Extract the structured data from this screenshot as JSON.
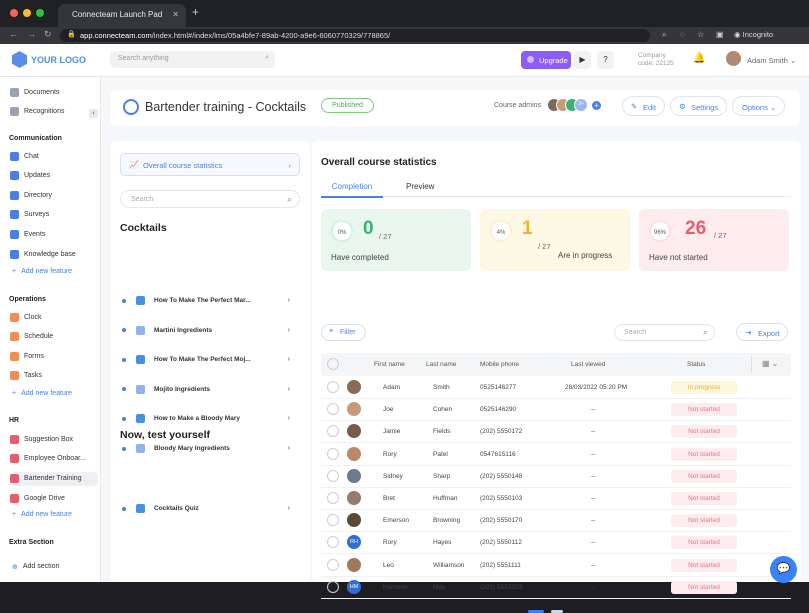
{
  "browser": {
    "tab_title": "Connecteam Launch Pad",
    "url_domain": "app.connecteam.com",
    "url_path": "/index.html#/index/lms/05a4bfe7-89ab-4200-a9e6-6060770329/778865/",
    "incognito": "Incognito"
  },
  "topbar": {
    "logo": "YOUR LOGO",
    "search_placeholder": "Search anything",
    "upgrade": "Upgrade",
    "play": "▶",
    "help": "?",
    "company_line1": "Company",
    "company_line2": "code: 22125",
    "user": "Adam Smith"
  },
  "sidebar": {
    "top": [
      {
        "label": "Documents",
        "color": "#9aa3b2"
      },
      {
        "label": "Recognitions",
        "color": "#9aa3b2"
      }
    ],
    "communication_title": "Communication",
    "communication": [
      {
        "label": "Chat",
        "color": "#4a7fe8"
      },
      {
        "label": "Updates",
        "color": "#4a7fe8"
      },
      {
        "label": "Directory",
        "color": "#4a7fe8"
      },
      {
        "label": "Surveys",
        "color": "#4a7fe8"
      },
      {
        "label": "Events",
        "color": "#4a7fe8"
      },
      {
        "label": "Knowledge base",
        "color": "#4a7fe8"
      }
    ],
    "add_feature": "Add new feature",
    "operations_title": "Operations",
    "operations": [
      {
        "label": "Clock",
        "color": "#f28b54"
      },
      {
        "label": "Schedule",
        "color": "#f28b54"
      },
      {
        "label": "Forms",
        "color": "#f28b54"
      },
      {
        "label": "Tasks",
        "color": "#f28b54"
      }
    ],
    "hr_title": "HR",
    "hr": [
      {
        "label": "Suggestion Box",
        "color": "#e85d6b"
      },
      {
        "label": "Employee Onboar...",
        "color": "#e85d6b"
      },
      {
        "label": "Bartender Training",
        "color": "#e85d6b"
      },
      {
        "label": "Google Drive",
        "color": "#e85d6b"
      }
    ],
    "extra_title": "Extra Section",
    "add_section": "Add section"
  },
  "header": {
    "title": "Bartender training - Cocktails",
    "status": "Published",
    "admins_label": "Course admins",
    "admins_more": "3+",
    "edit": "Edit",
    "settings": "Settings",
    "options": "Options"
  },
  "left": {
    "stats_link": "Overall course statistics",
    "search_placeholder": "Search",
    "section1": "Cocktails",
    "lessons": [
      "How To Make The Perfect Mar...",
      "Martini Ingredients",
      "How To Make The Perfect Moj...",
      "Mojito Ingredients",
      "How to Make a Bloody Mary",
      "Bloody Mary Ingredients"
    ],
    "section2": "Now, test yourself",
    "quiz": "Cocktails Quiz"
  },
  "main": {
    "title": "Overall course statistics",
    "tabs": [
      "Completion",
      "Preview"
    ],
    "cards": [
      {
        "pct": "0%",
        "count": "0",
        "of": "/ 27",
        "label": "Have completed",
        "bg": "#e8f6ee",
        "color": "#3cb371"
      },
      {
        "pct": "4%",
        "count": "1",
        "of": "/ 27",
        "label": "Are in progress",
        "bg": "#fdf8e4",
        "color": "#f0b429"
      },
      {
        "pct": "96%",
        "count": "26",
        "of": "/ 27",
        "label": "Have not started",
        "bg": "#fdecee",
        "color": "#e85d6b"
      }
    ],
    "filter": "Filter",
    "search_placeholder": "Search",
    "export": "Export",
    "columns": [
      "First name",
      "Last name",
      "Mobile phone",
      "Last viewed",
      "Status"
    ],
    "rows": [
      {
        "initials": "",
        "first": "Adam",
        "last": "Smith",
        "phone": "0525146277",
        "viewed": "28/03/2022 05:20 PM",
        "status": "In progress",
        "avatar": "#8a6a55"
      },
      {
        "initials": "",
        "first": "Joe",
        "last": "Cohen",
        "phone": "0525146290",
        "viewed": "--",
        "status": "Not started",
        "avatar": "#c69b7b"
      },
      {
        "initials": "",
        "first": "Jamie",
        "last": "Fields",
        "phone": "(202) 5550172",
        "viewed": "--",
        "status": "Not started",
        "avatar": "#7a5a4a"
      },
      {
        "initials": "",
        "first": "Rory",
        "last": "Patel",
        "phone": "0547615116",
        "viewed": "--",
        "status": "Not started",
        "avatar": "#b88a6a"
      },
      {
        "initials": "",
        "first": "Sidney",
        "last": "Sharp",
        "phone": "(202) 5550148",
        "viewed": "--",
        "status": "Not started",
        "avatar": "#6b7a8a"
      },
      {
        "initials": "",
        "first": "Bret",
        "last": "Huffman",
        "phone": "(202) 5550103",
        "viewed": "--",
        "status": "Not started",
        "avatar": "#9a7a6a"
      },
      {
        "initials": "",
        "first": "Emerson",
        "last": "Browning",
        "phone": "(202) 5550170",
        "viewed": "--",
        "status": "Not started",
        "avatar": "#5a4a3a"
      },
      {
        "initials": "RH",
        "first": "Rory",
        "last": "Hayes",
        "phone": "(202) 5550112",
        "viewed": "--",
        "status": "Not started",
        "avatar": "#2f6fd6"
      },
      {
        "initials": "",
        "first": "Leo",
        "last": "Williamson",
        "phone": "(202) 5551111",
        "viewed": "--",
        "status": "Not started",
        "avatar": "#a07a5a"
      },
      {
        "initials": "HM",
        "first": "Harrison",
        "last": "May",
        "phone": "(202) 5553333",
        "viewed": "--",
        "status": "Not started",
        "avatar": "#2f6fd6"
      }
    ]
  }
}
